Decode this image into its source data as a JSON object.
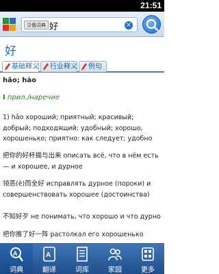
{
  "status_bar": {
    "time": "21:51"
  },
  "search": {
    "language_tag": "汉俄词典",
    "query": "好",
    "clear_icon": "clear-icon",
    "search_icon": "search-icon"
  },
  "entry": {
    "headword": "好",
    "tabs": [
      {
        "label": "基础释义",
        "active": true
      },
      {
        "label": "行业释义",
        "active": false
      },
      {
        "label": "例句",
        "active": false
      }
    ],
    "pronunciation": "hǎo; hào",
    "pos_marker": "I",
    "pos_label": "прил./наречие",
    "paragraphs": [
      "1) hǎo хороший; приятный; красивый; добрый; подходящий; удобный; хорошо, хорошенько; приятно: как следует; удобно",
      "把你的好杯描与出来 описать всё, что в нём есть — и хорошее, и дурное",
      "领恶(è)而全好 исправлять дурное (пороки) и совершенствовать хорошее (достоинства)",
      "不知好歹 не понимать, что хорошо и что дурно",
      "把你推了好一阵 растолкал его хорошенько"
    ]
  },
  "bottom_nav": [
    {
      "label": "词典",
      "icon": "dictionary-icon",
      "active": true
    },
    {
      "label": "翻译",
      "icon": "translate-icon",
      "active": false
    },
    {
      "label": "词库",
      "icon": "wordbook-icon",
      "active": false
    },
    {
      "label": "家园",
      "icon": "community-icon",
      "active": false
    },
    {
      "label": "更多",
      "icon": "more-icon",
      "active": false
    }
  ],
  "colors": {
    "accent": "#1a73d1",
    "nav_bg": "#1f4f8c",
    "pos_green": "#2e7d32"
  }
}
